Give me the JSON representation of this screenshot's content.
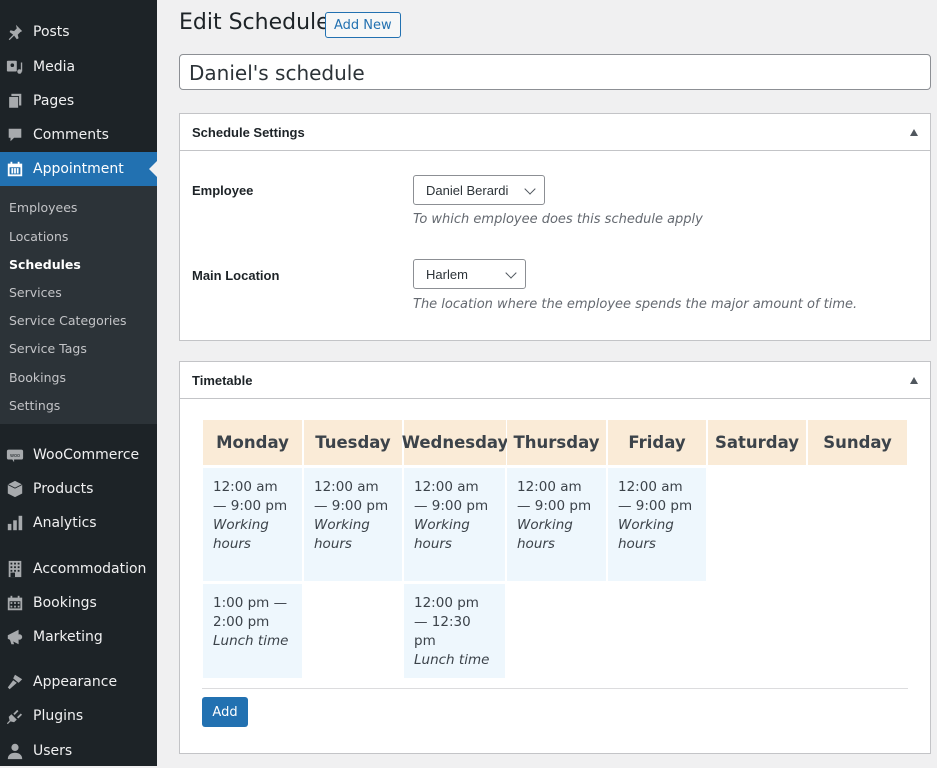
{
  "sidebar": {
    "top_items": [
      {
        "label": "Posts",
        "icon": "pin-icon"
      },
      {
        "label": "Media",
        "icon": "media-icon"
      },
      {
        "label": "Pages",
        "icon": "pages-icon"
      },
      {
        "label": "Comments",
        "icon": "comment-icon"
      },
      {
        "label": "Appointment",
        "icon": "calendar-icon",
        "active": true
      }
    ],
    "submenu": [
      {
        "label": "Employees"
      },
      {
        "label": "Locations"
      },
      {
        "label": "Schedules",
        "current": true
      },
      {
        "label": "Services"
      },
      {
        "label": "Service Categories"
      },
      {
        "label": "Service Tags"
      },
      {
        "label": "Bookings"
      },
      {
        "label": "Settings"
      }
    ],
    "bottom_items": [
      {
        "label": "WooCommerce",
        "icon": "woo-icon"
      },
      {
        "label": "Products",
        "icon": "box-icon"
      },
      {
        "label": "Analytics",
        "icon": "bar-chart-icon"
      },
      {
        "label": "Accommodation",
        "icon": "building-icon"
      },
      {
        "label": "Bookings",
        "icon": "calendar-icon"
      },
      {
        "label": "Marketing",
        "icon": "megaphone-icon"
      },
      {
        "label": "Appearance",
        "icon": "paintbrush-icon"
      },
      {
        "label": "Plugins",
        "icon": "plug-icon"
      },
      {
        "label": "Users",
        "icon": "user-icon"
      }
    ]
  },
  "header": {
    "title": "Edit Schedule",
    "add_new_label": "Add New"
  },
  "post_title": "Daniel's schedule",
  "settings_box": {
    "title": "Schedule Settings",
    "employee_label": "Employee",
    "employee_value": "Daniel Berardi",
    "employee_desc": "To which employee does this schedule apply",
    "location_label": "Main Location",
    "location_value": "Harlem",
    "location_desc": "The location where the employee spends the major amount of time."
  },
  "timetable_box": {
    "title": "Timetable",
    "days": [
      "Monday",
      "Tuesday",
      "Wednesday",
      "Thursday",
      "Friday",
      "Saturday",
      "Sunday"
    ],
    "slots": [
      {
        "day": "Monday",
        "time": "12:00 am — 9:00 pm",
        "kind": "Working hours"
      },
      {
        "day": "Tuesday",
        "time": "12:00 am — 9:00 pm",
        "kind": "Working hours"
      },
      {
        "day": "Wednesday",
        "time": "12:00 am — 9:00 pm",
        "kind": "Working hours"
      },
      {
        "day": "Thursday",
        "time": "12:00 am — 9:00 pm",
        "kind": "Working hours"
      },
      {
        "day": "Friday",
        "time": "12:00 am — 9:00 pm",
        "kind": "Working hours"
      },
      {
        "day": "Monday",
        "time": "1:00 pm — 2:00 pm",
        "kind": "Lunch time"
      },
      {
        "day": "Wednesday",
        "time": "12:00 pm — 12:30 pm",
        "kind": "Lunch time"
      }
    ],
    "add_label": "Add"
  }
}
